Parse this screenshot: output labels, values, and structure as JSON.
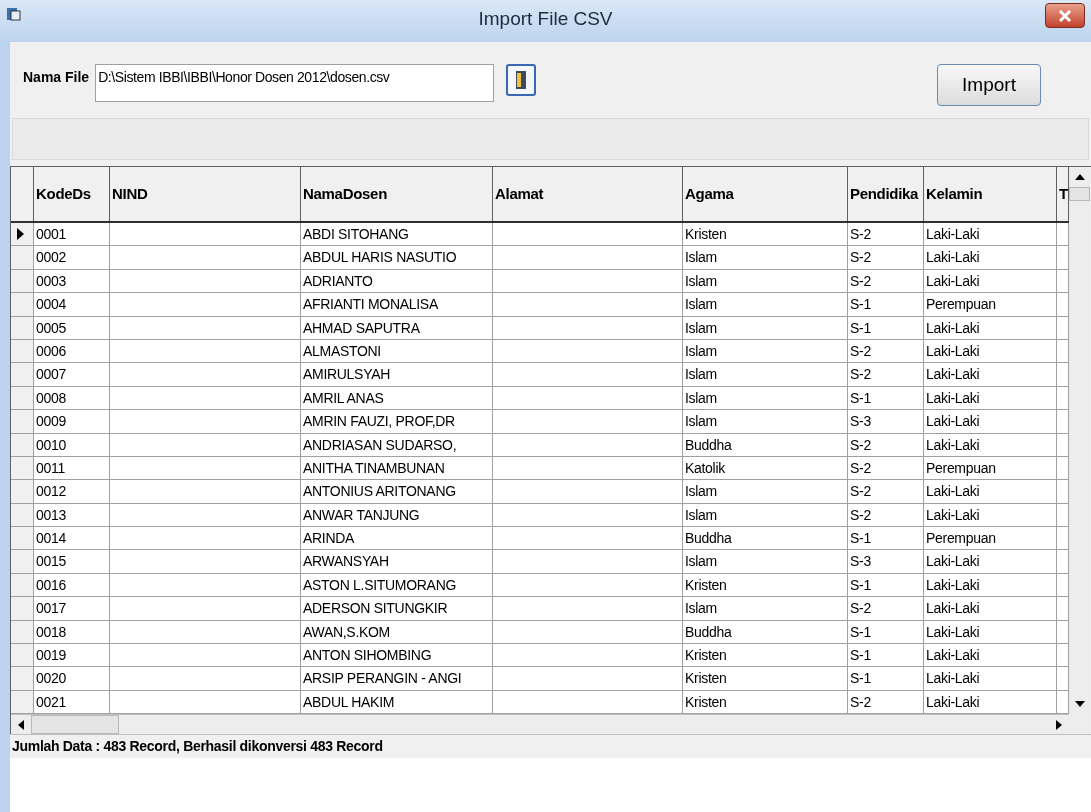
{
  "window": {
    "title": "Import File CSV"
  },
  "file": {
    "label": "Nama File",
    "value": "D:\\Sistem IBBI\\IBBI\\Honor Dosen 2012\\dosen.csv"
  },
  "import_button": "Import",
  "table": {
    "columns": [
      "KodeDs",
      "NIND",
      "NamaDosen",
      "Alamat",
      "Agama",
      "Pendidika",
      "Kelamin",
      "T"
    ],
    "rows": [
      {
        "selected": true,
        "kode": "0001",
        "nama": "ABDI SITOHANG",
        "agama": "Kristen",
        "pendidikan": "S-2",
        "kelamin": "Laki-Laki"
      },
      {
        "selected": false,
        "kode": "0002",
        "nama": "ABDUL HARIS NASUTIO",
        "agama": "Islam",
        "pendidikan": "S-2",
        "kelamin": "Laki-Laki"
      },
      {
        "selected": false,
        "kode": "0003",
        "nama": "ADRIANTO",
        "agama": "Islam",
        "pendidikan": "S-2",
        "kelamin": "Laki-Laki"
      },
      {
        "selected": false,
        "kode": "0004",
        "nama": "AFRIANTI MONALISA",
        "agama": "Islam",
        "pendidikan": "S-1",
        "kelamin": "Perempuan"
      },
      {
        "selected": false,
        "kode": "0005",
        "nama": "AHMAD SAPUTRA",
        "agama": "Islam",
        "pendidikan": "S-1",
        "kelamin": "Laki-Laki"
      },
      {
        "selected": false,
        "kode": "0006",
        "nama": "ALMASTONI",
        "agama": "Islam",
        "pendidikan": "S-2",
        "kelamin": "Laki-Laki"
      },
      {
        "selected": false,
        "kode": "0007",
        "nama": "AMIRULSYAH",
        "agama": "Islam",
        "pendidikan": "S-2",
        "kelamin": "Laki-Laki"
      },
      {
        "selected": false,
        "kode": "0008",
        "nama": "AMRIL ANAS",
        "agama": "Islam",
        "pendidikan": "S-1",
        "kelamin": "Laki-Laki"
      },
      {
        "selected": false,
        "kode": "0009",
        "nama": "AMRIN FAUZI, PROF,DR",
        "agama": "Islam",
        "pendidikan": "S-3",
        "kelamin": "Laki-Laki"
      },
      {
        "selected": false,
        "kode": "0010",
        "nama": "ANDRIASAN SUDARSO,",
        "agama": "Buddha",
        "pendidikan": "S-2",
        "kelamin": "Laki-Laki"
      },
      {
        "selected": false,
        "kode": "0011",
        "nama": "ANITHA TINAMBUNAN",
        "agama": "Katolik",
        "pendidikan": "S-2",
        "kelamin": "Perempuan"
      },
      {
        "selected": false,
        "kode": "0012",
        "nama": "ANTONIUS ARITONANG",
        "agama": "Islam",
        "pendidikan": "S-2",
        "kelamin": "Laki-Laki"
      },
      {
        "selected": false,
        "kode": "0013",
        "nama": "ANWAR TANJUNG",
        "agama": "Islam",
        "pendidikan": "S-2",
        "kelamin": "Laki-Laki"
      },
      {
        "selected": false,
        "kode": "0014",
        "nama": "ARINDA",
        "agama": "Buddha",
        "pendidikan": "S-1",
        "kelamin": "Perempuan"
      },
      {
        "selected": false,
        "kode": "0015",
        "nama": "ARWANSYAH",
        "agama": "Islam",
        "pendidikan": "S-3",
        "kelamin": "Laki-Laki"
      },
      {
        "selected": false,
        "kode": "0016",
        "nama": "ASTON L.SITUMORANG",
        "agama": "Kristen",
        "pendidikan": "S-1",
        "kelamin": "Laki-Laki"
      },
      {
        "selected": false,
        "kode": "0017",
        "nama": "ADERSON SITUNGKIR",
        "agama": "Islam",
        "pendidikan": "S-2",
        "kelamin": "Laki-Laki"
      },
      {
        "selected": false,
        "kode": "0018",
        "nama": "AWAN,S.KOM",
        "agama": "Buddha",
        "pendidikan": "S-1",
        "kelamin": "Laki-Laki"
      },
      {
        "selected": false,
        "kode": "0019",
        "nama": "ANTON SIHOMBING",
        "agama": "Kristen",
        "pendidikan": "S-1",
        "kelamin": "Laki-Laki"
      },
      {
        "selected": false,
        "kode": "0020",
        "nama": "ARSIP PERANGIN - ANGI",
        "agama": "Kristen",
        "pendidikan": "S-1",
        "kelamin": "Laki-Laki"
      },
      {
        "selected": false,
        "kode": "0021",
        "nama": "ABDUL HAKIM",
        "agama": "Kristen",
        "pendidikan": "S-2",
        "kelamin": "Laki-Laki"
      }
    ]
  },
  "status": "Jumlah Data : 483 Record, Berhasil dikonversi 483 Record"
}
